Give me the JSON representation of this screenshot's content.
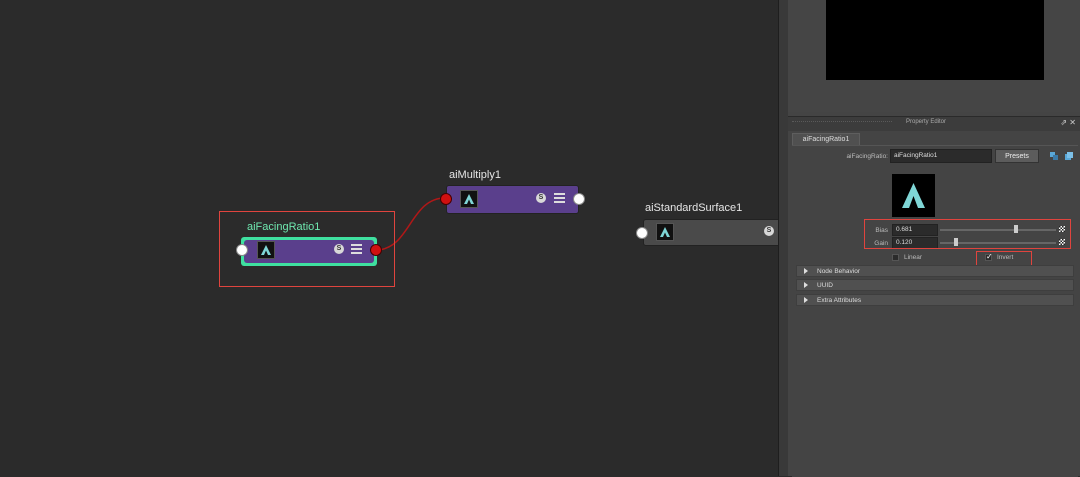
{
  "graph": {
    "nodes": [
      {
        "id": "facing",
        "title": "aiFacingRatio1"
      },
      {
        "id": "multiply",
        "title": "aiMultiply1"
      },
      {
        "id": "surface",
        "title": "aiStandardSurface1"
      }
    ],
    "s_badge": "S"
  },
  "property_editor": {
    "title": "Property Editor",
    "tab": "aiFacingRatio1",
    "node_name_label": "aiFacingRatio:",
    "node_name_value": "aiFacingRatio1",
    "presets_label": "Presets",
    "bias_label": "Bias",
    "bias_value": "0.681",
    "bias_fraction": 0.681,
    "gain_label": "Gain",
    "gain_value": "0.120",
    "gain_fraction": 0.12,
    "linear_label": "Linear",
    "linear_checked": false,
    "invert_label": "Invert",
    "invert_checked": true,
    "invert_check_mark": "✓",
    "sections": [
      "Node Behavior",
      "UUID",
      "Extra Attributes"
    ]
  },
  "colors": {
    "node_purple": "#5a3f8c",
    "node_gray": "#4a4a4a",
    "selected_outline": "#3fe0a0",
    "connection_red": "#b01818",
    "highlight_red": "#e0443e",
    "facing_label": "#6fe8b0",
    "icon_teal": "#7fd6d6"
  }
}
